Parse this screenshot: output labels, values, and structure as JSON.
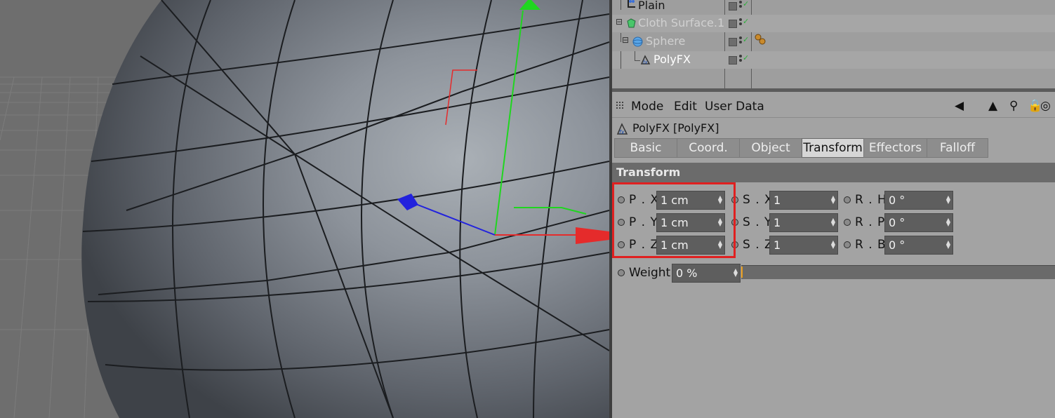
{
  "object_manager": {
    "objects": [
      {
        "name": "Plain",
        "icon": "null-object-icon"
      },
      {
        "name": "Cloth Surface.1",
        "icon": "cloth-surface-icon"
      },
      {
        "name": "Sphere",
        "icon": "sphere-icon"
      },
      {
        "name": "PolyFX",
        "icon": "polyfx-icon"
      }
    ]
  },
  "attribute_manager": {
    "menu": {
      "mode": "Mode",
      "edit": "Edit",
      "user_data": "User Data"
    },
    "object_title": "PolyFX [PolyFX]",
    "tabs": [
      "Basic",
      "Coord.",
      "Object",
      "Transform",
      "Effectors",
      "Falloff"
    ],
    "active_tab": "Transform",
    "section_title": "Transform",
    "params": {
      "px": {
        "label": "P . X",
        "value": "1 cm"
      },
      "py": {
        "label": "P . Y",
        "value": "1 cm"
      },
      "pz": {
        "label": "P . Z",
        "value": "1 cm"
      },
      "sx": {
        "label": "S . X",
        "value": "1"
      },
      "sy": {
        "label": "S . Y",
        "value": "1"
      },
      "sz": {
        "label": "S . Z",
        "value": "1"
      },
      "rh": {
        "label": "R . H",
        "value": "0 °"
      },
      "rp": {
        "label": "R . P",
        "value": "0 °"
      },
      "rb": {
        "label": "R . B",
        "value": "0 °"
      },
      "weight": {
        "label": "Weight",
        "value": "0 %",
        "level": 0
      }
    }
  },
  "colors": {
    "highlight": "#e02020",
    "axis_x": "#e52b2b",
    "axis_y": "#1fd61f",
    "axis_z": "#2222dd"
  }
}
